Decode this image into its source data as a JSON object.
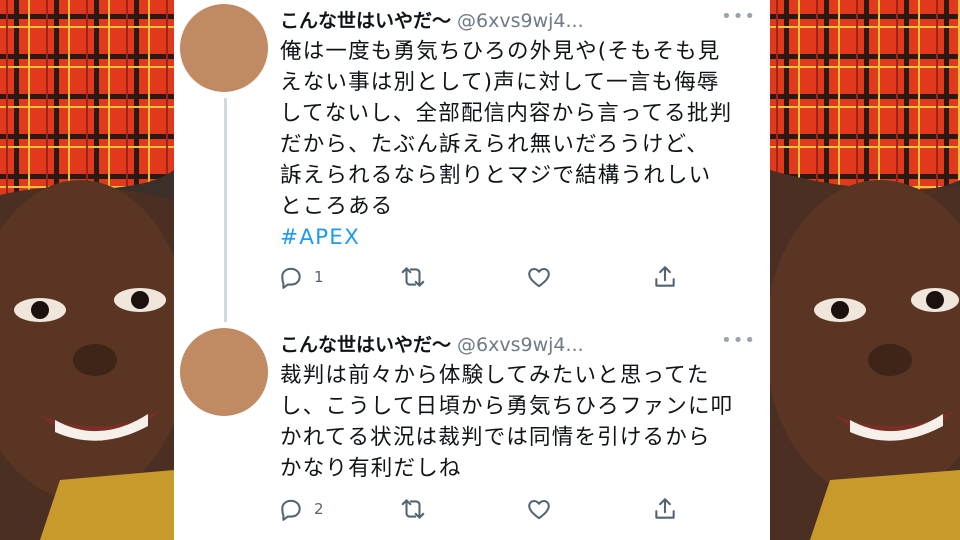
{
  "tweets": [
    {
      "name": "こんな世はいやだ〜",
      "handle": "@6xvs9wj4...",
      "more": "•••",
      "lines": [
        "俺は一度も勇気ちひろの外見や(そもそも見",
        "えない事は別として)声に対して一言も侮辱",
        "してないし、全部配信内容から言ってる批判",
        "だから、たぶん訴えられ無いだろうけど、",
        "訴えられるなら割りとマジで結構うれしい",
        "ところある"
      ],
      "hashtag": "#APEX",
      "reply_count": "1",
      "retweet_count": "",
      "like_count": ""
    },
    {
      "name": "こんな世はいやだ〜",
      "handle": "@6xvs9wj4...",
      "more": "•••",
      "lines": [
        "裁判は前々から体験してみたいと思ってた",
        "し、こうして日頃から勇気ちひろファンに叩",
        "かれてる状況は裁判では同情を引けるから",
        "かなり有利だしね"
      ],
      "reply_count": "2",
      "retweet_count": "",
      "like_count": ""
    }
  ],
  "colors": {
    "text": "#0f1419",
    "muted": "#536471",
    "hashtag": "#1d9bf0",
    "avatar": "#c08a62",
    "thread_line": "#cfd9de"
  },
  "icons": {
    "reply": "reply-icon",
    "retweet": "retweet-icon",
    "like": "heart-icon",
    "share": "share-icon"
  }
}
